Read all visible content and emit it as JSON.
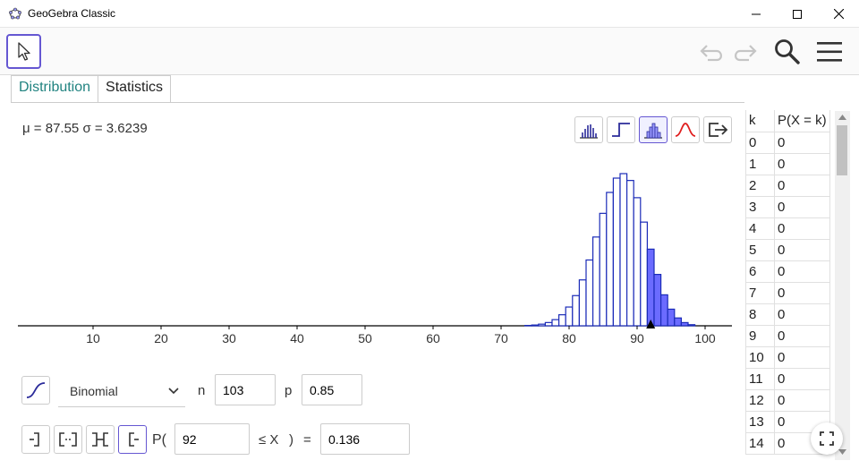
{
  "window": {
    "title": "GeoGebra Classic",
    "controls": [
      "minimize-icon",
      "maximize-icon",
      "close-icon"
    ]
  },
  "toolbar": {
    "tool": "move-arrow-icon",
    "icons": [
      "undo-icon",
      "redo-icon",
      "search-icon",
      "menu-icon"
    ]
  },
  "tabs": [
    {
      "label": "Distribution",
      "active": true
    },
    {
      "label": "Statistics",
      "active": false
    }
  ],
  "stats_text": "μ = 87.55 σ = 3.6239",
  "graph_buttons": [
    "bar-graph-icon",
    "step-graph-icon",
    "histogram-icon",
    "normal-curve-icon",
    "export-icon"
  ],
  "distribution": {
    "type": "Binomial",
    "n_label": "n",
    "n_value": "103",
    "p_label": "p",
    "p_value": "0.85",
    "cumulative_icon": "cumulative-curve-icon"
  },
  "probability": {
    "interval_buttons": [
      "left-sided-icon",
      "two-sided-icon",
      "interval-icon",
      "right-sided-icon"
    ],
    "prefix": "P(",
    "lower_value": "92",
    "relation": "≤ X",
    "close": ")",
    "equals": "=",
    "result": "0.136"
  },
  "chart_data": {
    "type": "bar",
    "x_ticks": [
      "10",
      "20",
      "30",
      "40",
      "50",
      "60",
      "70",
      "80",
      "90",
      "100"
    ],
    "xlim": [
      0,
      103
    ],
    "highlight_from": 92,
    "highlight_color": "#6b6bff",
    "bar_color": "#1b2bb8",
    "marker_x": 92,
    "n": 103,
    "p": 0.85
  },
  "table": {
    "headers": [
      "k",
      "P(X = k)"
    ],
    "rows": [
      [
        "0",
        "0"
      ],
      [
        "1",
        "0"
      ],
      [
        "2",
        "0"
      ],
      [
        "3",
        "0"
      ],
      [
        "4",
        "0"
      ],
      [
        "5",
        "0"
      ],
      [
        "6",
        "0"
      ],
      [
        "7",
        "0"
      ],
      [
        "8",
        "0"
      ],
      [
        "9",
        "0"
      ],
      [
        "10",
        "0"
      ],
      [
        "11",
        "0"
      ],
      [
        "12",
        "0"
      ],
      [
        "13",
        "0"
      ],
      [
        "14",
        "0"
      ]
    ]
  }
}
